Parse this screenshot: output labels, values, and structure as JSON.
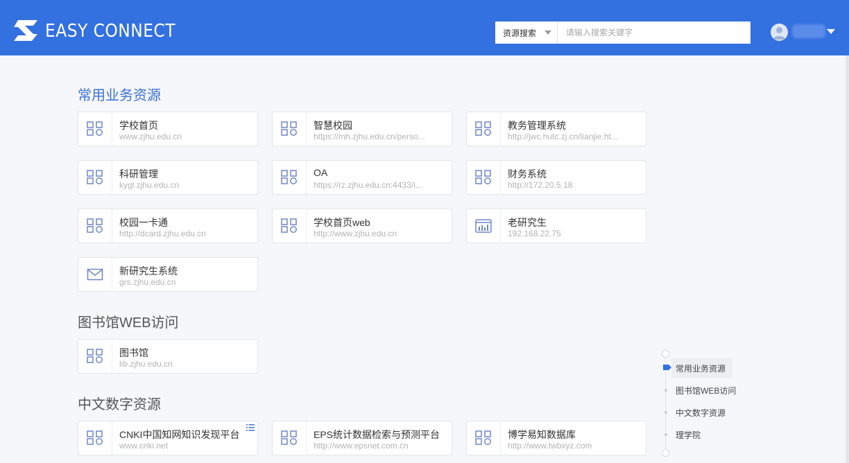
{
  "header": {
    "brand": "EASY CONNECT",
    "brand_color": "#3370e0",
    "search_type": "资源搜索",
    "search_placeholder": "请输入搜索关键字",
    "search_value": ""
  },
  "sections": [
    {
      "title": "常用业务资源",
      "items": [
        {
          "name": "学校首页",
          "url": "www.zjhu.edu.cn",
          "icon": "grid-icon"
        },
        {
          "name": "智慧校园",
          "url": "https://mh.zjhu.edu.cn/perso...",
          "icon": "grid-icon"
        },
        {
          "name": "教务管理系统",
          "url": "http://jwc.hutc.zj.cn/lianjie.ht...",
          "icon": "grid-icon"
        },
        {
          "name": "科研管理",
          "url": "kygl.zjhu.edu.cn",
          "icon": "grid-icon"
        },
        {
          "name": "OA",
          "url": "https://rz.zjhu.edu.cn:4433/i...",
          "icon": "grid-icon"
        },
        {
          "name": "财务系统",
          "url": "http://172.20.5.18",
          "icon": "grid-icon"
        },
        {
          "name": "校园一卡通",
          "url": "http://dcard.zjhu.edu.cn",
          "icon": "grid-icon"
        },
        {
          "name": "学校首页web",
          "url": "http://www.zjhu.edu.cn",
          "icon": "grid-icon"
        },
        {
          "name": "老研究生",
          "url": "192.168.22.75",
          "icon": "chart-icon"
        },
        {
          "name": "新研究生系统",
          "url": "grs.zjhu.edu.cn",
          "icon": "mail-icon"
        }
      ]
    },
    {
      "title": "图书馆WEB访问",
      "items": [
        {
          "name": "图书馆",
          "url": "lib.zjhu.edu.cn",
          "icon": "grid-icon"
        }
      ]
    },
    {
      "title": "中文数字资源",
      "items": [
        {
          "name": "CNKI中国知网知识发现平台",
          "url": "www.cnki.net",
          "icon": "grid-icon",
          "badge": "list-icon"
        },
        {
          "name": "EPS统计数据检索与预测平台",
          "url": "http://www.epsnet.com.cn",
          "icon": "grid-icon"
        },
        {
          "name": "博学易知数据库",
          "url": "http://www.twbxyz.com",
          "icon": "grid-icon"
        }
      ]
    }
  ],
  "anchor_nav": {
    "items": [
      "常用业务资源",
      "图书馆WEB访问",
      "中文数字资源",
      "理学院"
    ],
    "active": "常用业务资源"
  }
}
